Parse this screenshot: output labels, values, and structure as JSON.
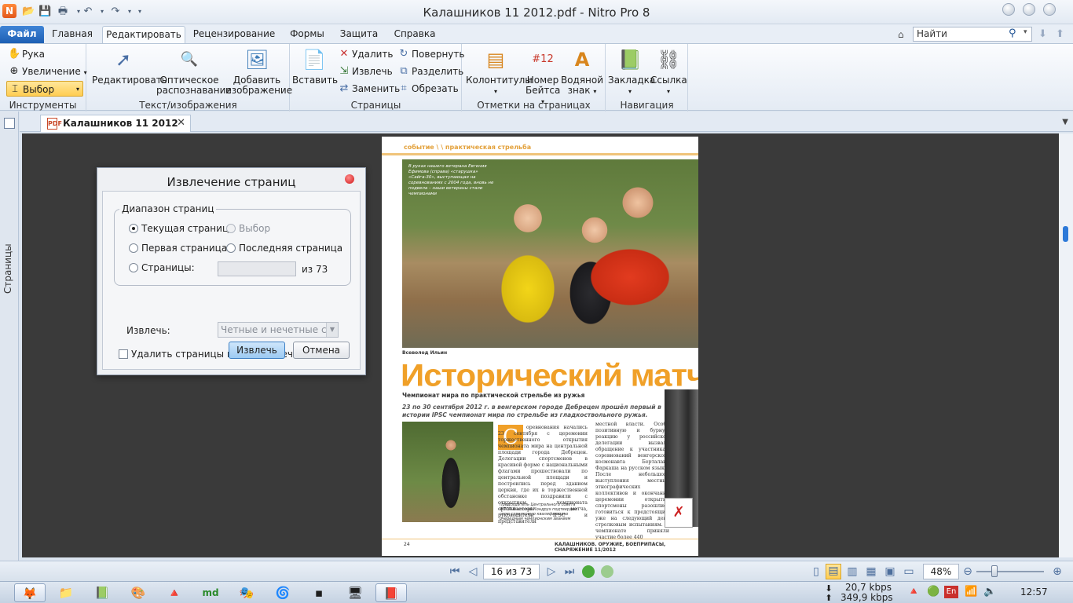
{
  "window": {
    "title": "Калашников 11 2012.pdf - Nitro Pro 8",
    "logo_letter": "N"
  },
  "menu": {
    "tabs": [
      "Файл",
      "Главная",
      "Редактировать",
      "Рецензирование",
      "Формы",
      "Защита",
      "Справка"
    ],
    "search_placeholder": "Найти"
  },
  "ribbon": {
    "tools": {
      "label": "Инструменты",
      "hand": "Рука",
      "zoom": "Увеличение",
      "select": "Выбор"
    },
    "text_images": {
      "label": "Текст/изображения",
      "edit": "Редактировать",
      "ocr_line1": "Оптическое",
      "ocr_line2": "распознавание",
      "add_image_line1": "Добавить",
      "add_image_line2": "изображение"
    },
    "pages": {
      "label": "Страницы",
      "insert": "Вставить",
      "delete": "Удалить",
      "extract": "Извлечь",
      "replace": "Заменить",
      "rotate": "Повернуть",
      "split": "Разделить",
      "crop": "Обрезать"
    },
    "page_marks": {
      "label": "Отметки на страницах",
      "headers": "Колонтитулы",
      "bates_line1": "Номер",
      "bates_line2": "Бейтса",
      "watermark_line1": "Водяной",
      "watermark_line2": "знак"
    },
    "navigation": {
      "label": "Навигация",
      "bookmark": "Закладка",
      "link": "Ссылка"
    }
  },
  "side_panel": {
    "pages_label": "Страницы"
  },
  "document": {
    "tab_title": "Калашников 11 2012"
  },
  "pdf": {
    "header": "событие \\ \\ практическая стрельба",
    "photo_caption": "В руках нашего ветерана Евгения Ефимова (справа) «старушка» «Сайга-30», выступающая на соревнованиях с 2004 года, вновь не подвела – наши ветераны стали чемпионами",
    "author": "Всеволод Ильин",
    "headline": "Исторический матч",
    "subhead": "Чемпионат мира по практической стрельбе из ружья",
    "lead": "23 по 30 сентября 2012 г. в венгерском городе Дебрецен прошёл первый в истории IPSC чемпионат мира по стрельбе из гладкоствольного ружья.",
    "dropcap": "С",
    "col1": "оревнования начались 23 сентября с церемонии торжественного открытия чемпионата мира на центральной площади города Дебрецен. Делегации спортсменов в красивой форме с национальными флагами прошествовали по центральной площади и построились перед зданием церкви, где их в торжественной обстановке поздравили с открытием чемпионата организаторы матча, руководители IPSC и представители",
    "col2": "местной власти. Особо позитивную и бурную реакцию у российской делегации вызвало обращение к участникам соревнований венгерского космонавта Берталана Фаркаша на русском языке! После небольшого выступления местных этнографических коллективов и окончания церемонии открытия спортсмены разошлись готовиться к предстоящим уже на следующий день стрелковым испытаниям.     В чемпионате приняли участие более 440",
    "small_caption": "Председатель Центрального совета ФПСР Анатолий Кондрух подтвердил свою стрелковую квалификацию очередным чемпионским званием",
    "page_number": "24",
    "footer": "КАЛАШНИКОВ. ОРУЖИЕ, БОЕПРИПАСЫ, СНАРЯЖЕНИЕ 11/2012"
  },
  "dialog": {
    "title": "Извлечение страниц",
    "range_title": "Диапазон страниц",
    "current_page": "Текущая страница",
    "selection": "Выбор",
    "first_page": "Первая страница",
    "last_page": "Последняя страница",
    "pages": "Страницы:",
    "pages_value": "",
    "of_total": "из 73",
    "extract_label": "Извлечь:",
    "extract_option": "Четные и нечетные стран",
    "delete_after": "Удалить страницы после извлечения",
    "extract_button": "Извлечь",
    "cancel_button": "Отмена"
  },
  "statusbar": {
    "page_indicator": "16 из 73",
    "zoom": "48%"
  },
  "taskbar": {
    "download_rate": "20,7 kbps",
    "upload_rate": "349,9 kbps",
    "language": "En",
    "clock": "12:57"
  }
}
